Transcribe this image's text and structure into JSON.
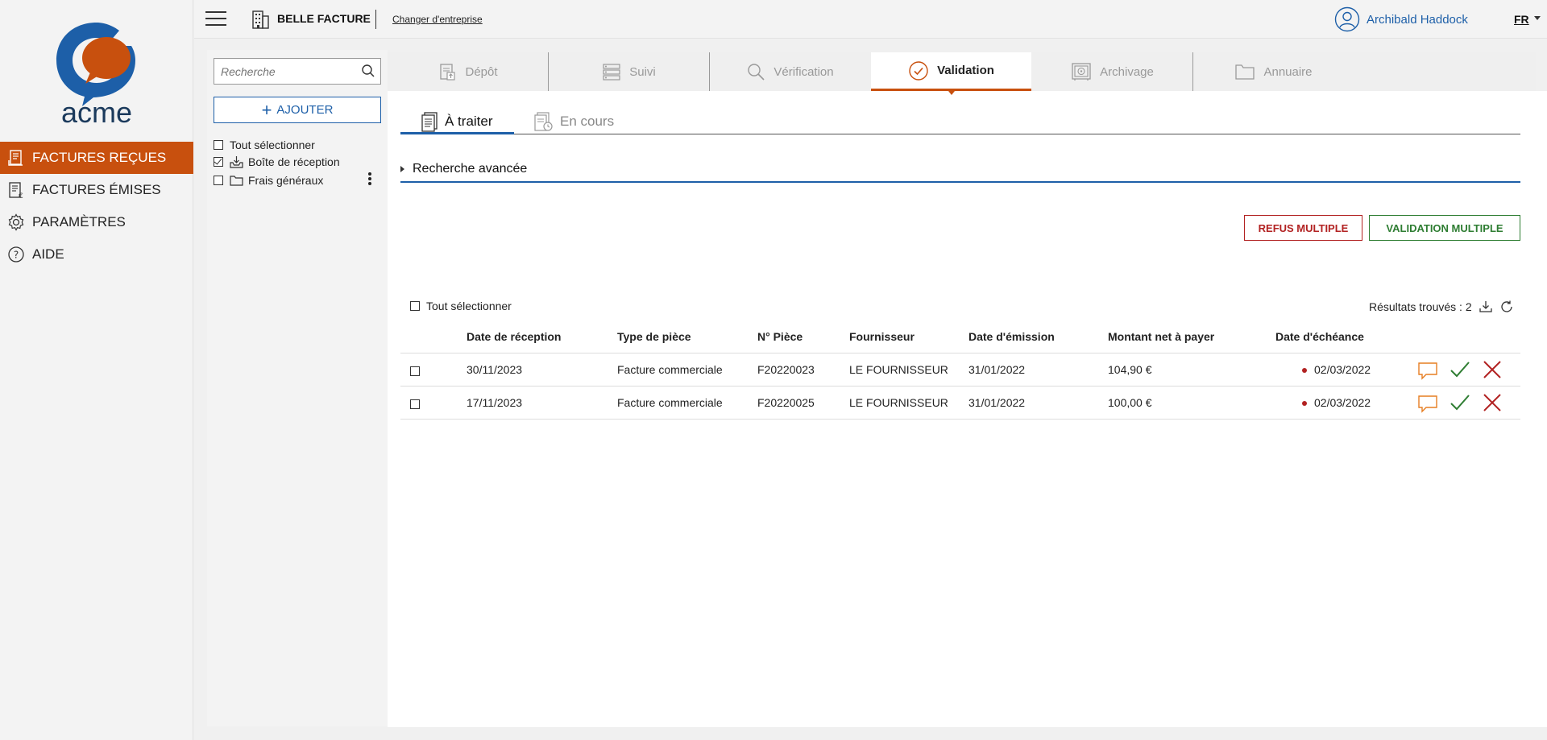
{
  "brand": {
    "logo_text": "acme",
    "accent": "#c8500e",
    "primary": "#1d5fa8"
  },
  "sidebar": {
    "items": [
      {
        "label": "FACTURES REÇUES",
        "icon": "received-invoices-icon",
        "active": true
      },
      {
        "label": "FACTURES ÉMISES",
        "icon": "issued-invoices-icon",
        "active": false
      },
      {
        "label": "PARAMÈTRES",
        "icon": "gear-icon",
        "active": false
      },
      {
        "label": "AIDE",
        "icon": "help-icon",
        "active": false
      }
    ]
  },
  "topbar": {
    "company": "BELLE FACTURE",
    "change_company": "Changer d'entreprise",
    "user": "Archibald Haddock",
    "lang": "FR"
  },
  "leftpanel": {
    "search_placeholder": "Recherche",
    "add_label": "AJOUTER",
    "select_all": "Tout sélectionner",
    "folders": [
      {
        "label": "Boîte de réception",
        "checked": true,
        "icon": "inbox-icon"
      },
      {
        "label": "Frais généraux",
        "checked": false,
        "icon": "folder-icon"
      }
    ]
  },
  "tabs": [
    {
      "label": "Dépôt",
      "icon": "deposit-icon"
    },
    {
      "label": "Suivi",
      "icon": "list-icon"
    },
    {
      "label": "Vérification",
      "icon": "search-icon"
    },
    {
      "label": "Validation",
      "icon": "check-circle-icon",
      "active": true
    },
    {
      "label": "Archivage",
      "icon": "safe-icon"
    },
    {
      "label": "Annuaire",
      "icon": "folder-icon"
    }
  ],
  "subtabs": [
    {
      "label": "À traiter",
      "active": true
    },
    {
      "label": "En cours",
      "active": false
    }
  ],
  "advanced_search": "Recherche avancée",
  "actions": {
    "refus": "REFUS MULTIPLE",
    "validation": "VALIDATION MULTIPLE"
  },
  "table": {
    "select_all": "Tout sélectionner",
    "results": "Résultats trouvés : 2",
    "columns": [
      "Date de réception",
      "Type de pièce",
      "N° Pièce",
      "Fournisseur",
      "Date d'émission",
      "Montant net à payer",
      "Date d'échéance"
    ],
    "rows": [
      [
        "30/11/2023",
        "Facture commerciale",
        "F20220023",
        "LE FOURNISSEUR",
        "31/01/2022",
        "104,90 €",
        "02/03/2022"
      ],
      [
        "17/11/2023",
        "Facture commerciale",
        "F20220025",
        "LE FOURNISSEUR",
        "31/01/2022",
        "100,00 €",
        "02/03/2022"
      ]
    ]
  }
}
